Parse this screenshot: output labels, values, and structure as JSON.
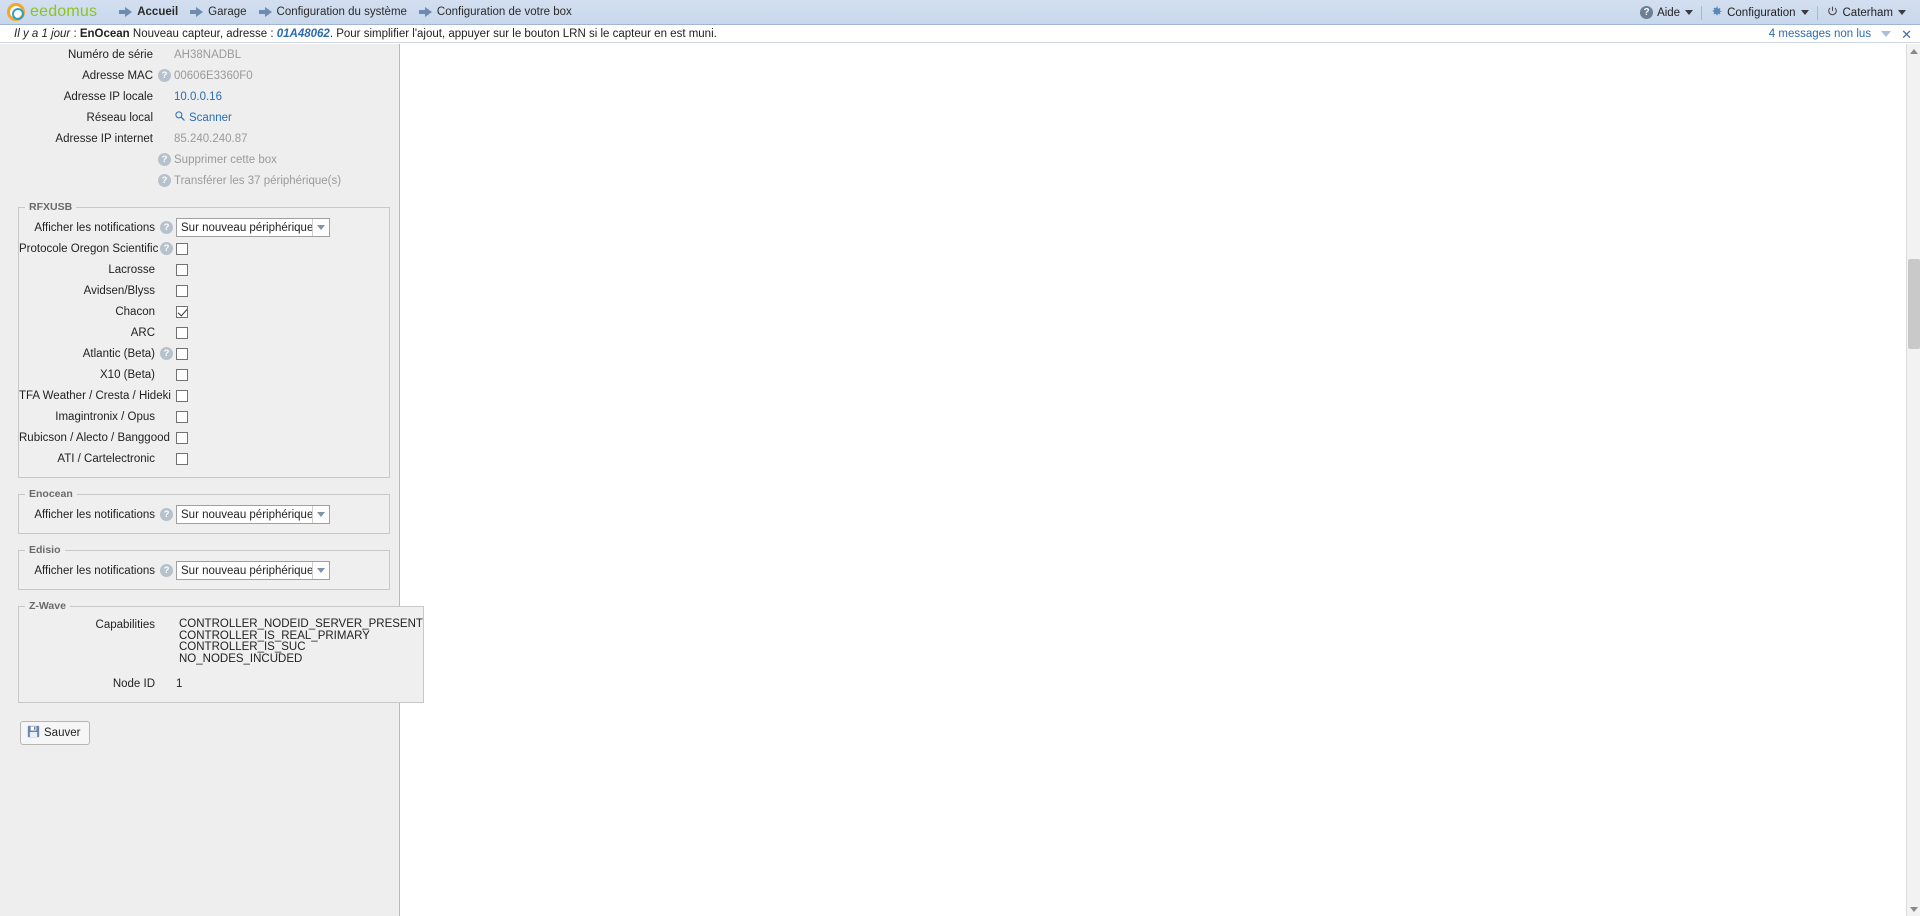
{
  "topbar": {
    "brand": {
      "ee": "ee",
      "domus": "domus",
      "logo_icon": "eedomus-ring-logo"
    },
    "nav": [
      {
        "label": "Accueil",
        "icon": "arrow-right-icon",
        "active": true
      },
      {
        "label": "Garage",
        "icon": "arrow-right-icon",
        "active": false
      },
      {
        "label": "Configuration du système",
        "icon": "arrow-right-icon",
        "active": false
      },
      {
        "label": "Configuration de votre box",
        "icon": "arrow-right-icon",
        "active": false
      }
    ],
    "right": {
      "help": {
        "label": "Aide",
        "icon": "help-circle-icon"
      },
      "config": {
        "label": "Configuration",
        "icon": "gear-icon"
      },
      "user": {
        "label": "Caterham",
        "icon": "power-icon"
      }
    }
  },
  "message_bar": {
    "ago": "Il y a 1 jour",
    "separator": " : ",
    "source": "EnOcean",
    "text_before": " Nouveau capteur, adresse : ",
    "address": "01A48062",
    "text_after": ". Pour simplifier l'ajout, appuyer sur le bouton LRN si le capteur en est muni.",
    "unread": "4 messages non lus",
    "collapse_icon": "triangle-down-icon",
    "close_icon": "close-icon"
  },
  "box_info": {
    "serial": {
      "label": "Numéro de série",
      "value": "AH38NADBL"
    },
    "mac": {
      "label": "Adresse MAC",
      "value": "00606E3360F0",
      "help": "?"
    },
    "local_ip": {
      "label": "Adresse IP locale",
      "value": "10.0.0.16"
    },
    "local_network": {
      "label": "Réseau local",
      "action": "Scanner",
      "icon": "magnifier-icon"
    },
    "internet_ip": {
      "label": "Adresse IP internet",
      "value": "85.240.240.87"
    },
    "delete_box": {
      "label": "Supprimer cette box",
      "help": "?"
    },
    "transfer": {
      "label": "Transférer les 37 périphérique(s)",
      "help": "?"
    }
  },
  "rfxusb": {
    "legend": "RFXUSB",
    "notifications": {
      "label": "Afficher les notifications",
      "help": "?",
      "value": "Sur nouveau périphérique"
    },
    "checkboxes": [
      {
        "label": "Protocole Oregon Scientific",
        "checked": false,
        "help": "?"
      },
      {
        "label": "Lacrosse",
        "checked": false,
        "help": null
      },
      {
        "label": "Avidsen/Blyss",
        "checked": false,
        "help": null
      },
      {
        "label": "Chacon",
        "checked": true,
        "help": null
      },
      {
        "label": "ARC",
        "checked": false,
        "help": null
      },
      {
        "label": "Atlantic (Beta)",
        "checked": false,
        "help": "?"
      },
      {
        "label": "X10 (Beta)",
        "checked": false,
        "help": null
      },
      {
        "label": "TFA Weather / Cresta / Hideki",
        "checked": false,
        "help": null
      },
      {
        "label": "Imagintronix / Opus",
        "checked": false,
        "help": null
      },
      {
        "label": "Rubicson / Alecto / Banggood",
        "checked": false,
        "help": null
      },
      {
        "label": "ATI / Cartelectronic",
        "checked": false,
        "help": null
      }
    ]
  },
  "enocean": {
    "legend": "Enocean",
    "notifications": {
      "label": "Afficher les notifications",
      "help": "?",
      "value": "Sur nouveau périphérique"
    }
  },
  "edisio": {
    "legend": "Edisio",
    "notifications": {
      "label": "Afficher les notifications",
      "help": "?",
      "value": "Sur nouveau périphérique"
    }
  },
  "zwave": {
    "legend": "Z-Wave",
    "capabilities_label": "Capabilities",
    "capabilities": [
      "CONTROLLER_NODEID_SERVER_PRESENT",
      "CONTROLLER_IS_REAL_PRIMARY",
      "CONTROLLER_IS_SUC",
      "NO_NODES_INCUDED"
    ],
    "node_id_label": "Node ID",
    "node_id": "1"
  },
  "actions": {
    "save_label": "Sauver",
    "save_icon": "floppy-disk-icon"
  },
  "colors": {
    "topbar_bg": "#d0dcef",
    "brand_green": "#8fc31f",
    "brand_orange": "#f5a623",
    "link_blue": "#2b6cb0",
    "panel_bg": "#eeeeee"
  }
}
